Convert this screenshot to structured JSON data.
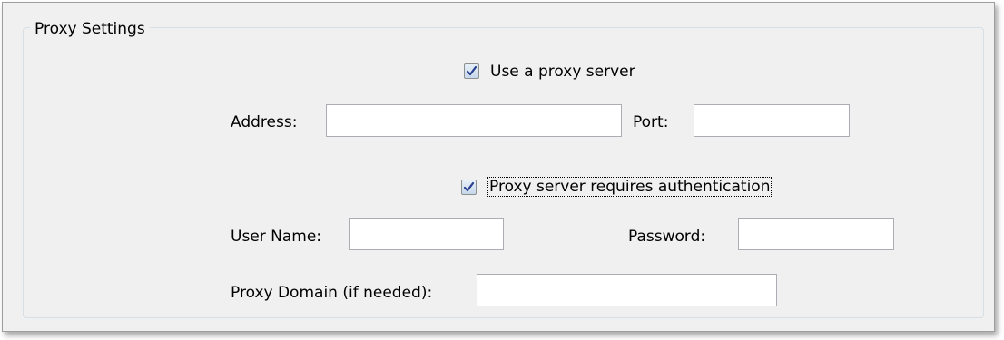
{
  "group": {
    "title": "Proxy Settings"
  },
  "use_proxy": {
    "label": "Use a proxy server",
    "checked": true
  },
  "address": {
    "label": "Address:",
    "value": ""
  },
  "port": {
    "label": "Port:",
    "value": ""
  },
  "requires_auth": {
    "label": "Proxy server requires authentication",
    "checked": true
  },
  "user_name": {
    "label": "User Name:",
    "value": ""
  },
  "password": {
    "label": "Password:",
    "value": ""
  },
  "proxy_domain": {
    "label": "Proxy Domain (if needed):",
    "value": ""
  },
  "icons": {
    "checkmark": "checkmark-icon"
  }
}
